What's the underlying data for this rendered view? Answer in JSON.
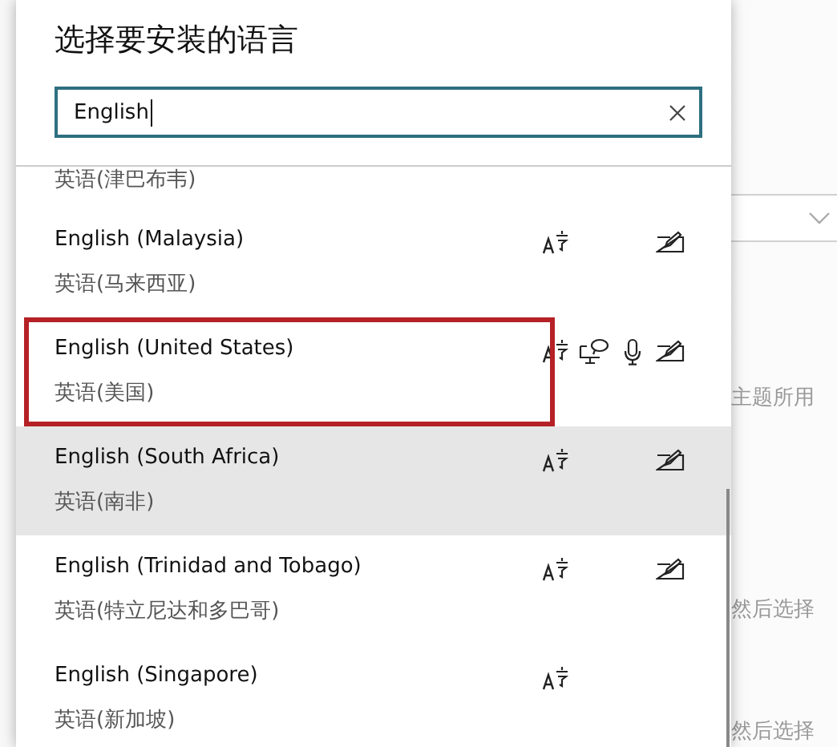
{
  "background": {
    "texts": [
      "主题所用",
      "然后选择",
      "然后选择"
    ]
  },
  "dialog": {
    "title": "选择要安装的语言",
    "search": {
      "value": "English"
    },
    "languages": [
      {
        "native": "英语(津巴布韦)",
        "highlighted": false,
        "annotated": false
      },
      {
        "name": "English (Malaysia)",
        "native": "英语(马来西亚)",
        "font": true,
        "text_to_speech": false,
        "speech": false,
        "handwriting": true,
        "highlighted": false,
        "annotated": false
      },
      {
        "name": "English (United States)",
        "native": "英语(美国)",
        "font": true,
        "text_to_speech": true,
        "speech": true,
        "handwriting": true,
        "highlighted": false,
        "annotated": true
      },
      {
        "name": "English (South Africa)",
        "native": "英语(南非)",
        "font": true,
        "text_to_speech": false,
        "speech": false,
        "handwriting": true,
        "highlighted": true,
        "annotated": false
      },
      {
        "name": "English (Trinidad and Tobago)",
        "native": "英语(特立尼达和多巴哥)",
        "font": true,
        "text_to_speech": false,
        "speech": false,
        "handwriting": true,
        "highlighted": false,
        "annotated": false
      },
      {
        "name": "English (Singapore)",
        "native": "英语(新加坡)",
        "font": true,
        "text_to_speech": false,
        "speech": false,
        "handwriting": false,
        "highlighted": false,
        "annotated": false
      }
    ]
  }
}
